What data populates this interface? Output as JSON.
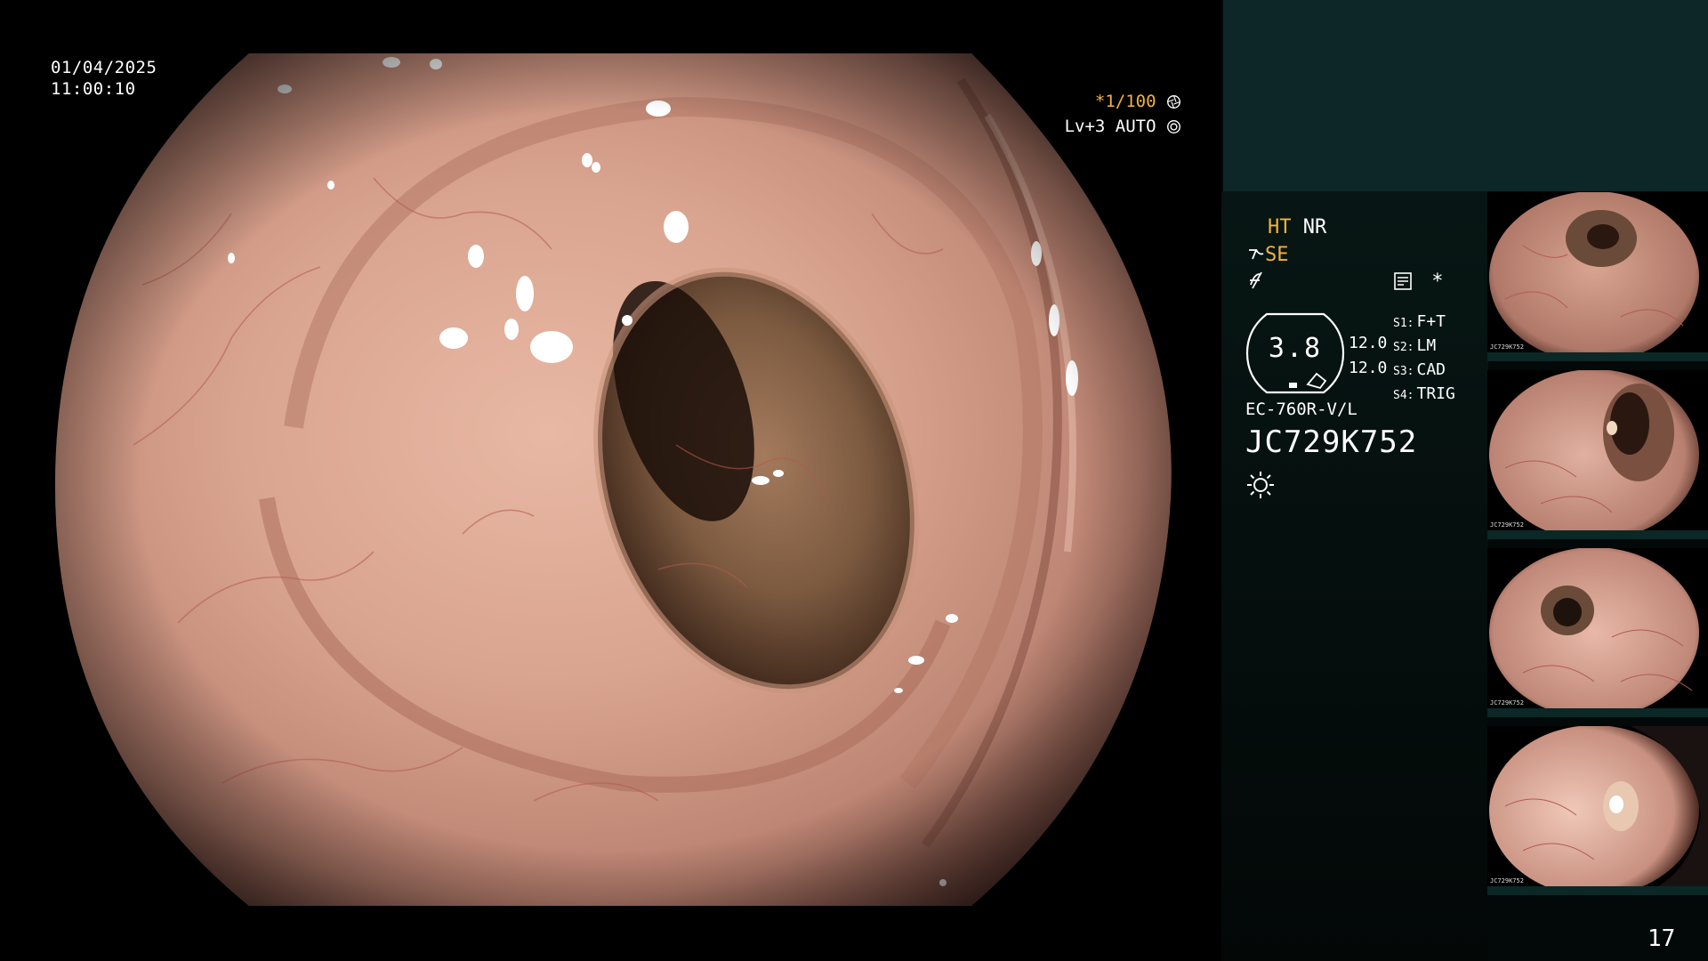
{
  "osd": {
    "date": "01/04/2025",
    "time": "11:00:10",
    "shutter_prefix": "*",
    "shutter_speed": "1/100",
    "iris_level": "Lv+3",
    "iris_mode": "AUTO"
  },
  "panel": {
    "ht": "HT",
    "nr": "NR",
    "se": "SE",
    "memo_symbol": "*",
    "enhancement_value": "3.8",
    "enhancement_levels": [
      "12.0",
      "12.0"
    ],
    "switches": [
      {
        "key": "S1:",
        "value": "F+T"
      },
      {
        "key": "S2:",
        "value": "LM"
      },
      {
        "key": "S3:",
        "value": "CAD"
      },
      {
        "key": "S4:",
        "value": "TRIG"
      }
    ],
    "scope_model": "EC-760R-V/L",
    "scope_serial": "JC729K752",
    "page_number": "17"
  },
  "thumbnails": [
    {
      "id_label": "JC729K752"
    },
    {
      "id_label": "JC729K752"
    },
    {
      "id_label": "JC729K752"
    },
    {
      "id_label": "JC729K752"
    }
  ],
  "icons": {
    "shutter": "aperture-icon",
    "iris": "iris-icon",
    "light": "sun-icon",
    "memo": "memo-icon",
    "struct": "structure-enhance-icon",
    "f": "function-icon"
  },
  "colors": {
    "accent_amber": "#f0b43c",
    "panel_dark": "#030807",
    "panel_top": "#0d2628"
  }
}
